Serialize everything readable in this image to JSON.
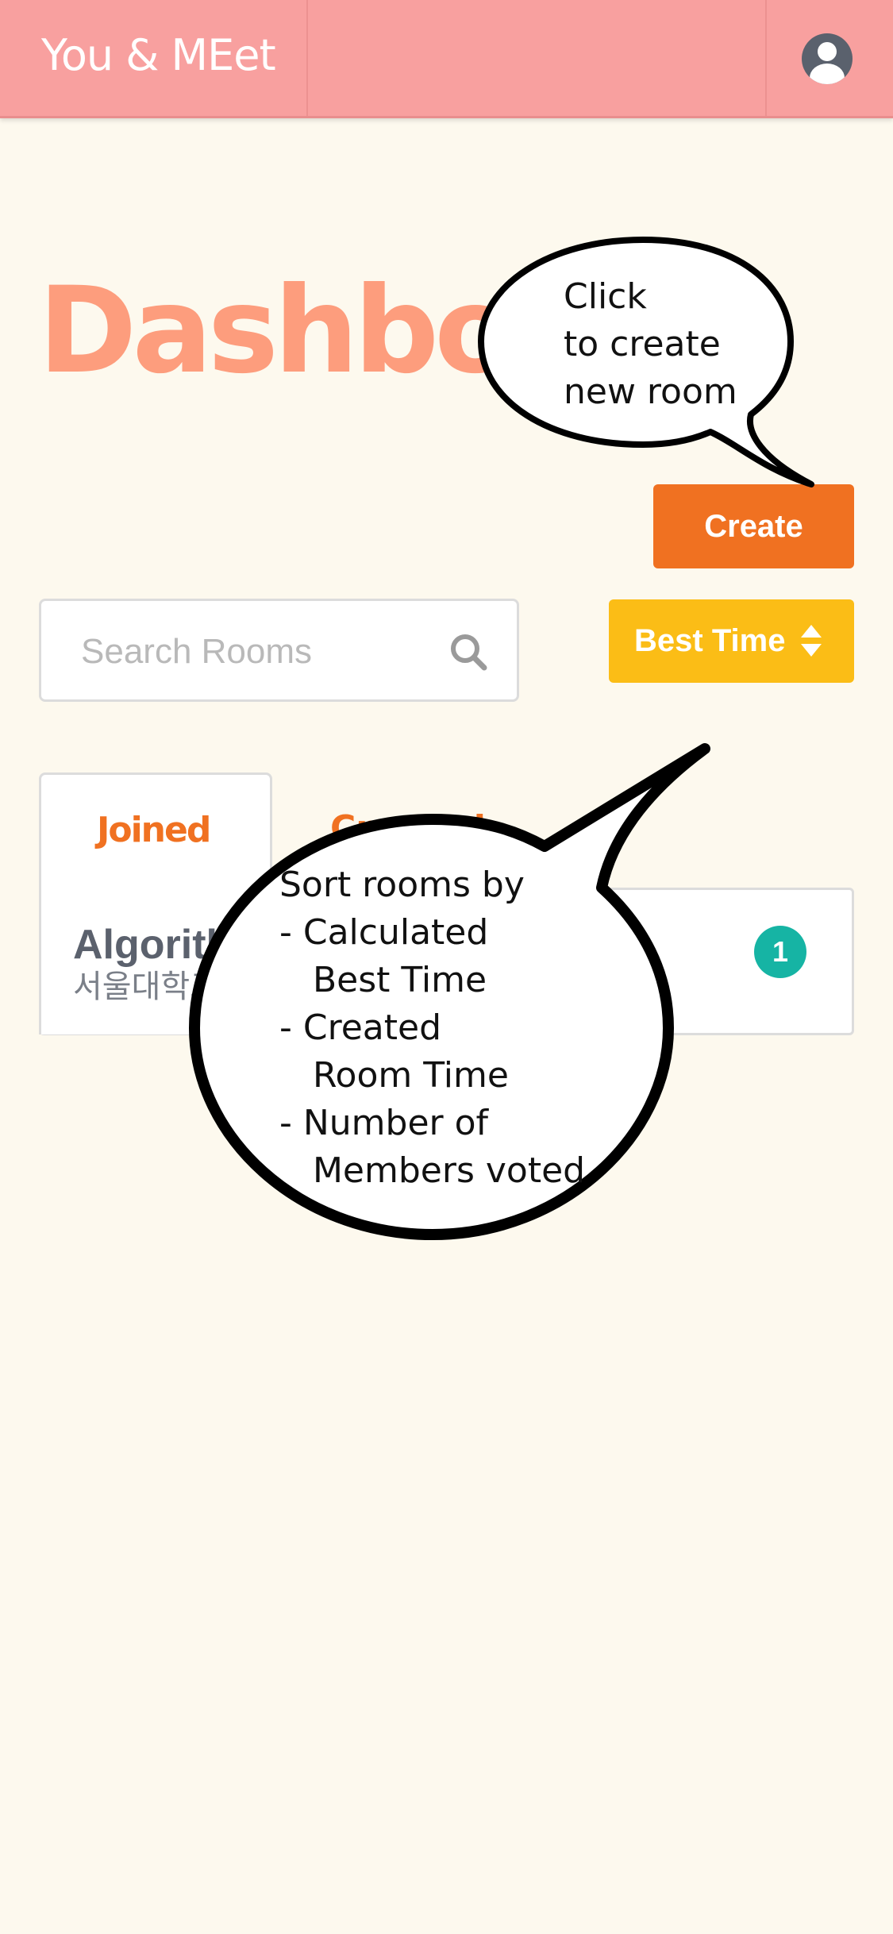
{
  "app": {
    "brand": "You & MEet"
  },
  "page": {
    "title": "Dashboard"
  },
  "toolbar": {
    "create_label": "Create",
    "sort_label": "Best Time"
  },
  "search": {
    "placeholder": "Search Rooms",
    "value": ""
  },
  "tabs": [
    {
      "label": "Joined",
      "active": true
    },
    {
      "label": "Created",
      "active": false
    }
  ],
  "rooms": [
    {
      "name": "Algorithm",
      "subtitle": "서울대학교",
      "count": "1"
    }
  ],
  "callouts": {
    "create": "Click\nto create\nnew room",
    "sort": "Sort rooms by\n- Calculated\n   Best Time\n- Created\n   Room Time\n- Number of\n   Members voted"
  },
  "colors": {
    "navbar": "#f8a09f",
    "background": "#fdf9ee",
    "title": "#fd9d7d",
    "create_button": "#f07121",
    "sort_button": "#fbbd16",
    "badge": "#16b4a4",
    "tab_text": "#f07121"
  },
  "icons": {
    "search": "search-icon",
    "sort": "sort-caret-icon",
    "avatar": "user-avatar-icon"
  }
}
